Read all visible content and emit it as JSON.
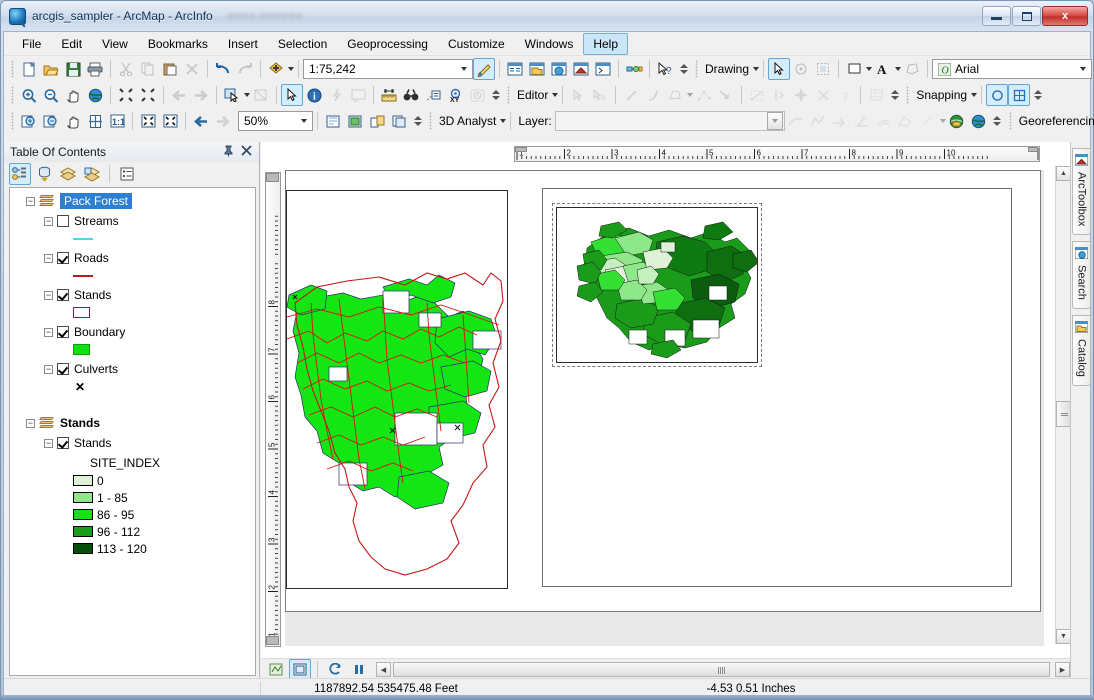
{
  "window": {
    "title": "arcgis_sampler - ArcMap - ArcInfo",
    "icon": "arcmap-globe-icon",
    "minimize": "minimize-button",
    "maximize": "maximize-button",
    "close_label": "x"
  },
  "menubar": {
    "items": [
      {
        "label": "File",
        "active": false
      },
      {
        "label": "Edit",
        "active": false
      },
      {
        "label": "View",
        "active": false
      },
      {
        "label": "Bookmarks",
        "active": false
      },
      {
        "label": "Insert",
        "active": false
      },
      {
        "label": "Selection",
        "active": false
      },
      {
        "label": "Geoprocessing",
        "active": false
      },
      {
        "label": "Customize",
        "active": false
      },
      {
        "label": "Windows",
        "active": false
      },
      {
        "label": "Help",
        "active": true
      }
    ]
  },
  "toolbars": {
    "standard": {
      "scale_value": "1:75,242",
      "buttons": [
        "new-map",
        "open",
        "save",
        "print",
        "cut",
        "copy",
        "paste",
        "delete",
        "undo",
        "redo",
        "add-data",
        "editor-toolbar-toggle",
        "map-document-properties"
      ]
    },
    "drawing": {
      "label": "Drawing",
      "font_name": "Arial",
      "font_icon": "font-italic-icon"
    },
    "editor": {
      "label": "Editor"
    },
    "snapping": {
      "label": "Snapping"
    },
    "georeferencing": {
      "label": "Georeferencing"
    },
    "analyst3d": {
      "label": "3D Analyst",
      "layer_label": "Layer:",
      "layer_value": ""
    },
    "layout": {
      "zoom_value": "50%"
    }
  },
  "toc": {
    "title": "Table Of Contents",
    "pin": "auto-hide-pin-icon",
    "close": "close-panel-icon",
    "toolbar": [
      {
        "name": "list-by-drawing-order",
        "selected": true
      },
      {
        "name": "list-by-source",
        "selected": false
      },
      {
        "name": "list-by-visibility",
        "selected": false
      },
      {
        "name": "list-by-selection",
        "selected": false
      },
      {
        "name": "options",
        "selected": false
      }
    ],
    "dataframes": [
      {
        "name": "Pack Forest",
        "selected": true,
        "layers": [
          {
            "name": "Streams",
            "checked": false,
            "symbol_type": "line",
            "color": "#4ad9e8"
          },
          {
            "name": "Roads",
            "checked": true,
            "symbol_type": "line",
            "color": "#b02020"
          },
          {
            "name": "Stands",
            "checked": true,
            "symbol_type": "hollow-polygon",
            "color": "#7b1f6e"
          },
          {
            "name": "Boundary",
            "checked": true,
            "symbol_type": "polygon",
            "color": "#12e012"
          },
          {
            "name": "Culverts",
            "checked": true,
            "symbol_type": "marker-x",
            "color": "#000000"
          }
        ]
      },
      {
        "name": "Stands",
        "selected": false,
        "layers": [
          {
            "name": "Stands",
            "checked": true,
            "symbol_type": "graduated",
            "field": "SITE_INDEX",
            "classes": [
              {
                "label": "0",
                "color": "#dff2d8"
              },
              {
                "label": "1 - 85",
                "color": "#8ee88a"
              },
              {
                "label": "86 - 95",
                "color": "#16e316"
              },
              {
                "label": "96 - 112",
                "color": "#1a9c1a"
              },
              {
                "label": "113 - 120",
                "color": "#054f0a"
              }
            ]
          }
        ]
      }
    ]
  },
  "rulers": {
    "horizontal_ticks": [
      "1",
      "2",
      "3",
      "4",
      "5",
      "6",
      "7",
      "8",
      "9",
      "10"
    ],
    "vertical_ticks": [
      "1",
      "2",
      "3",
      "4",
      "5",
      "6",
      "7",
      "8"
    ]
  },
  "right_dock": {
    "tabs": [
      {
        "label": "ArcToolbox",
        "icon": "arctoolbox-icon"
      },
      {
        "label": "Search",
        "icon": "search-icon"
      },
      {
        "label": "Catalog",
        "icon": "catalog-icon"
      }
    ]
  },
  "view_bar": {
    "buttons": [
      {
        "name": "data-view-button",
        "selected": false
      },
      {
        "name": "layout-view-button",
        "selected": true
      },
      {
        "name": "refresh-view-button",
        "selected": false
      },
      {
        "name": "pause-drawing-button",
        "selected": false
      }
    ]
  },
  "statusbar": {
    "coordinates": "1187892.54  535475.48 Feet",
    "page_coordinates": "-4.53  0.51 Inches"
  },
  "map": {
    "data_frame_label": "Pack Forest",
    "inset_label": "Stands"
  }
}
